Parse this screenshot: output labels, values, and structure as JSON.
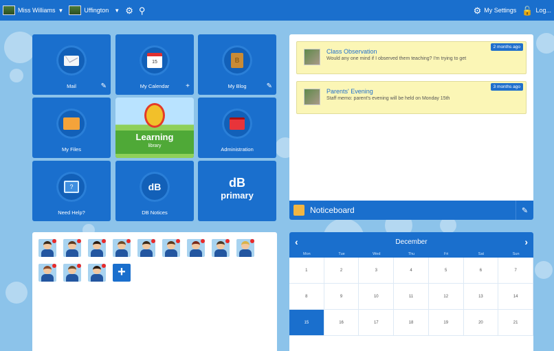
{
  "topbar": {
    "user_name": "Miss Williams",
    "school_name": "Uffington",
    "settings_label": "My Settings",
    "logout_label": "Log..."
  },
  "tiles": [
    {
      "label": "Mail",
      "icon": "mail-icon",
      "corner": "✎"
    },
    {
      "label": "My Calendar",
      "icon": "calendar-icon",
      "corner": "+"
    },
    {
      "label": "My Blog",
      "icon": "blog-icon",
      "corner": "✎"
    },
    {
      "label": "My Files",
      "icon": "folder-icon",
      "corner": ""
    },
    {
      "label": "Learning",
      "sublabel": "library",
      "icon": "learning-library-logo"
    },
    {
      "label": "Administration",
      "icon": "briefcase-icon",
      "corner": ""
    },
    {
      "label": "Need Help?",
      "icon": "help-icon",
      "corner": ""
    },
    {
      "label": "DB Notices",
      "icon": "db-notices-icon",
      "corner": ""
    },
    {
      "label": "primary",
      "logo_text": "dB",
      "icon": "db-primary-logo"
    }
  ],
  "calendar_tile_day": "15",
  "notices": [
    {
      "title": "Class Observation",
      "body": "Would any one mind if I observed them teaching? I'm trying to get",
      "ago": "2 months ago"
    },
    {
      "title": "Parents' Evening",
      "body": "Staff memo: parent's evening will be held on Monday 15th",
      "ago": "3 months ago"
    }
  ],
  "noticeboard": {
    "label": "Noticeboard"
  },
  "calendar": {
    "month": "December",
    "days": [
      "Mon",
      "Tue",
      "Wed",
      "Thu",
      "Fri",
      "Sat",
      "Sun"
    ],
    "dates": [
      "1",
      "2",
      "3",
      "4",
      "5",
      "6",
      "7",
      "8",
      "9",
      "10",
      "11",
      "12",
      "13",
      "14",
      "15",
      "16",
      "17",
      "18",
      "19",
      "20",
      "21"
    ],
    "today": "15"
  },
  "pupils": {
    "count": 12,
    "add_label": "+"
  },
  "colors": {
    "primary": "#1a6fcd",
    "background": "#8cc3ea",
    "note": "#fbf6b6",
    "alert_dot": "#e82a2a"
  }
}
